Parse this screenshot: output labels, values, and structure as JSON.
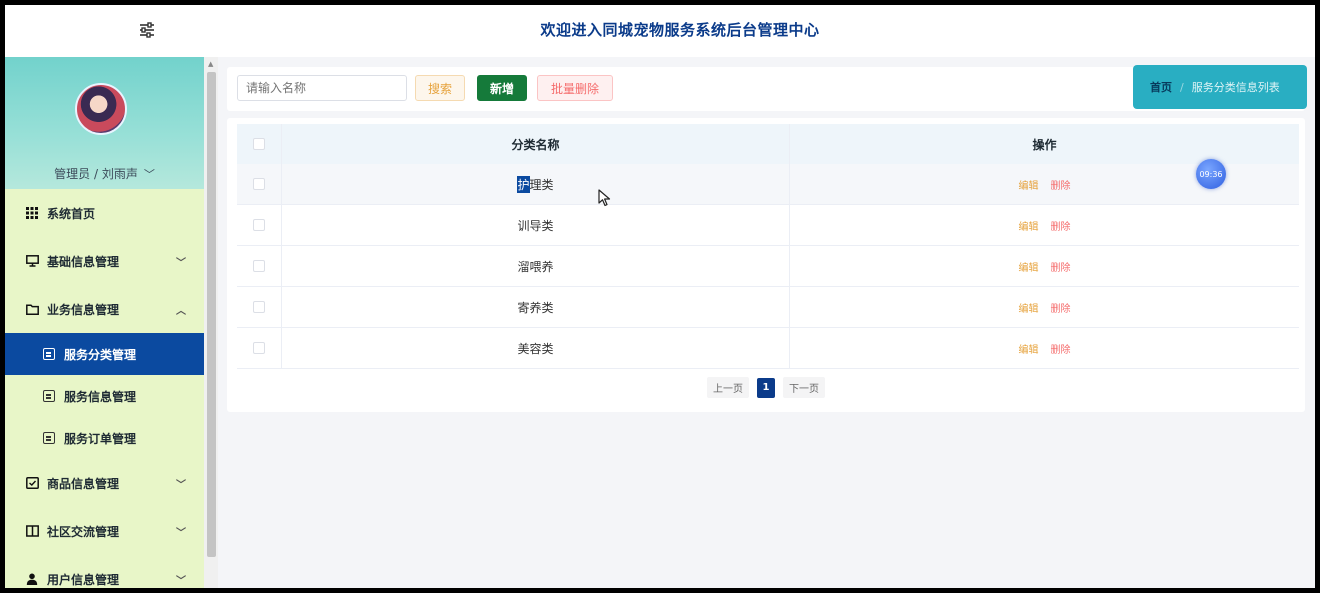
{
  "header": {
    "title": "欢迎进入同城宠物服务系统后台管理中心",
    "menu_icon": "sliders-icon"
  },
  "profile": {
    "user_label": "管理员 / 刘雨声"
  },
  "sidebar": {
    "items": [
      {
        "label": "系统首页",
        "icon": "grid-icon"
      },
      {
        "label": "基础信息管理",
        "icon": "monitor-icon",
        "expanded": false
      },
      {
        "label": "业务信息管理",
        "icon": "folder-icon",
        "expanded": true
      },
      {
        "label": "商品信息管理",
        "icon": "folder-check-icon",
        "expanded": false
      },
      {
        "label": "社区交流管理",
        "icon": "book-icon",
        "expanded": false
      },
      {
        "label": "用户信息管理",
        "icon": "user-icon",
        "expanded": false
      }
    ],
    "sub_items": [
      {
        "label": "服务分类管理",
        "active": true
      },
      {
        "label": "服务信息管理",
        "active": false
      },
      {
        "label": "服务订单管理",
        "active": false
      }
    ]
  },
  "toolbar": {
    "search_placeholder": "请输入名称",
    "search_label": "搜索",
    "add_label": "新增",
    "batch_delete_label": "批量删除"
  },
  "breadcrumb": {
    "home": "首页",
    "separator": "/",
    "current": "服务分类信息列表"
  },
  "table": {
    "headers": {
      "name": "分类名称",
      "actions": "操作"
    },
    "rows": [
      {
        "name_selected": "护",
        "name_rest": "理类"
      },
      {
        "name": "训导类"
      },
      {
        "name": "溜喂养"
      },
      {
        "name": "寄养类"
      },
      {
        "name": "美容类"
      }
    ],
    "edit_label": "编辑",
    "delete_label": "删除"
  },
  "pagination": {
    "prev": "上一页",
    "current": "1",
    "next": "下一页"
  },
  "overlay": {
    "time": "09:36"
  },
  "colors": {
    "primary": "#0b4aa0",
    "title": "#0b3b8a",
    "breadcrumb_bg": "#29aec2",
    "add_button": "#157a3a",
    "sidebar_bg": "#e8f6c8",
    "profile_bg": "#72d2cc"
  }
}
